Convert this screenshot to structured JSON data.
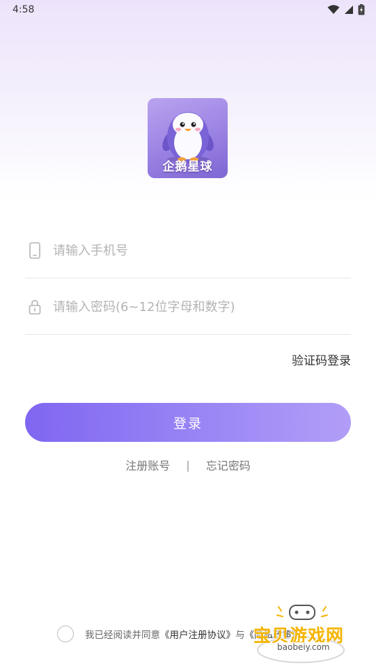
{
  "status_bar": {
    "time": "4:58"
  },
  "logo": {
    "text": "企鹅星球"
  },
  "form": {
    "phone_placeholder": "请输入手机号",
    "password_placeholder": "请输入密码(6~12位字母和数字)",
    "sms_login_label": "验证码登录",
    "login_label": "登录"
  },
  "links": {
    "register_label": "注册账号",
    "separator": "|",
    "forgot_label": "忘记密码"
  },
  "agreement": {
    "prefix": "我已经阅读并同意",
    "user_agreement": "《用户注册协议》",
    "conjunction": "与",
    "privacy_policy": "《隐私政策》"
  },
  "watermark": {
    "title": "宝贝游戏网",
    "url": "baobeiy.com"
  },
  "colors": {
    "accent": "#8066f1",
    "accent_light": "#b29ef7",
    "watermark_yellow": "#f5b400"
  }
}
